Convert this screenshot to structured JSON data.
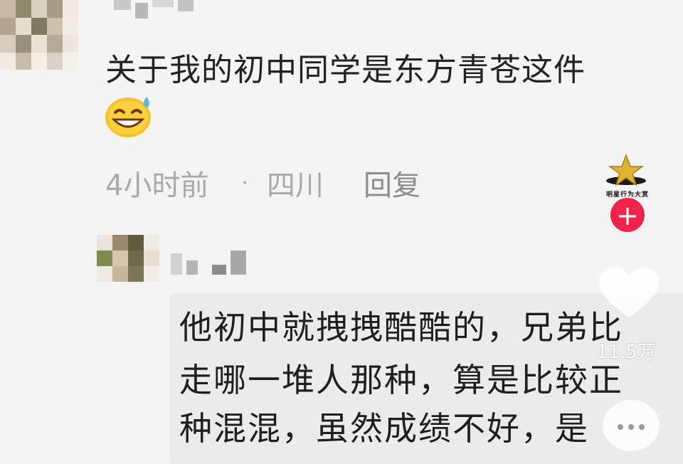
{
  "comment": {
    "text": "关于我的初中同学是东方青苍这件",
    "emoji": "sweat-smile-emoji",
    "time": "4小时前",
    "separator": "·",
    "location": "四川",
    "reply_label": "回复"
  },
  "reply": {
    "lines": [
      "他初中就拽拽酷酷的，兄弟比",
      "走哪一堆人那种，算是比较正",
      "种混混，虽然成绩不好，是"
    ]
  },
  "overlay": {
    "watermark_text": "明星行为大赏",
    "follow_symbol": "+",
    "like_count": "11.5万",
    "icons": [
      "star-logo-icon",
      "heart-icon",
      "comment-bubble-icon"
    ]
  },
  "colors": {
    "background": "#f4f4f4",
    "meta_text": "#a9a9a9",
    "follow_red": "#f2224a",
    "reply_bubble": "#ebebeb"
  }
}
